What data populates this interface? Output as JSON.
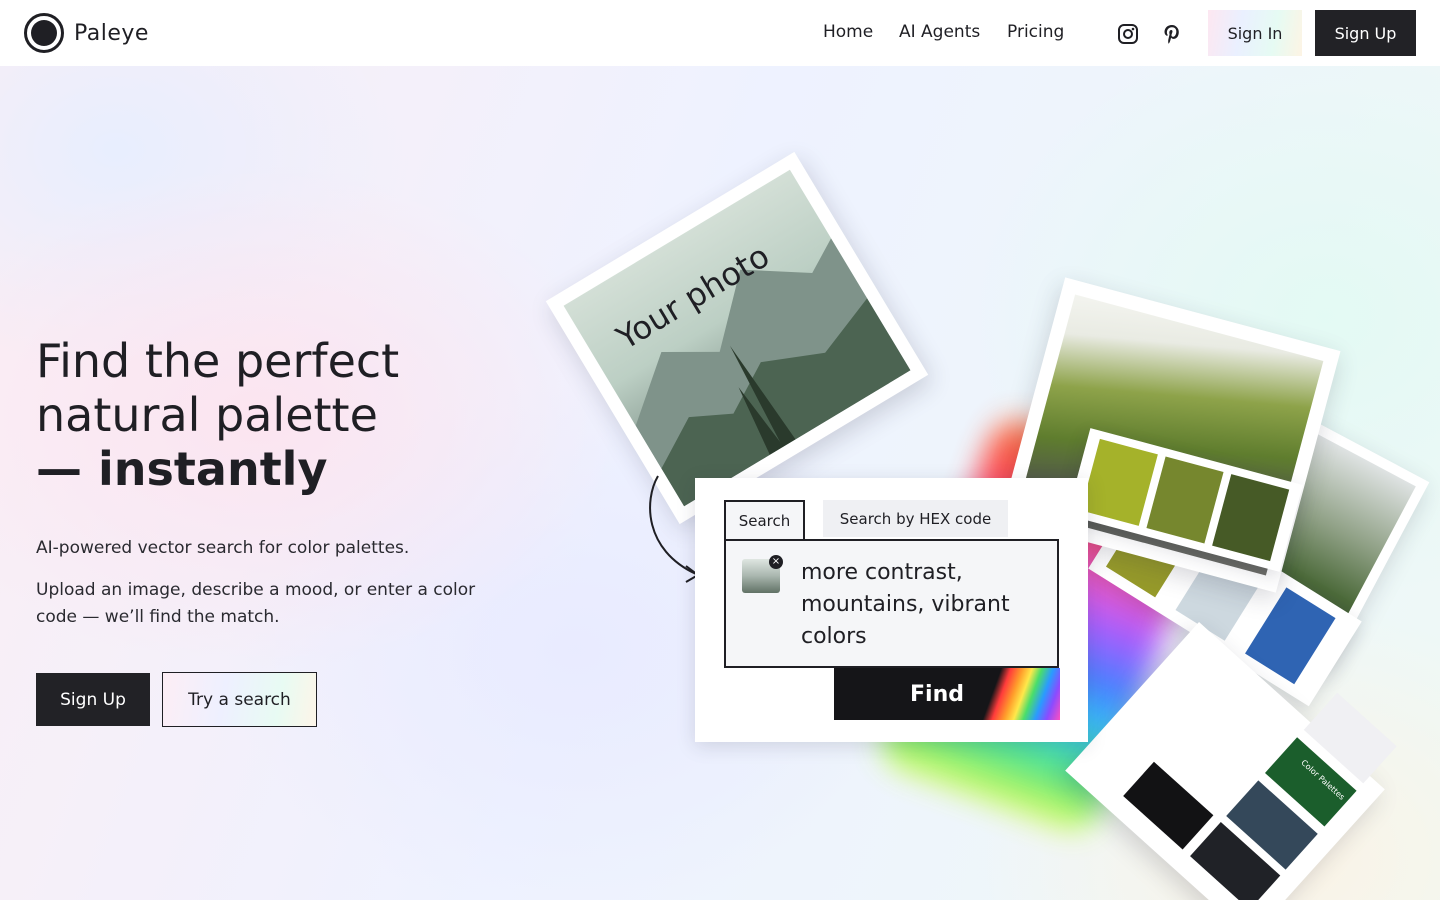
{
  "header": {
    "brand": "Paleye",
    "nav": [
      {
        "label": "Home"
      },
      {
        "label": "AI Agents"
      },
      {
        "label": "Pricing"
      }
    ],
    "social": [
      {
        "icon": "instagram-icon"
      },
      {
        "icon": "pinterest-icon"
      }
    ],
    "sign_in": "Sign In",
    "sign_up": "Sign Up"
  },
  "hero": {
    "title_line1": "Find the perfect",
    "title_line2": "natural palette",
    "title_line3": "— instantly",
    "subtitle": "AI-powered vector search for color palettes.",
    "description": "Upload an image, describe a mood, or enter a color code — we’ll find the match.",
    "primary_cta": "Sign Up",
    "secondary_cta": "Try a search"
  },
  "illustration": {
    "photo_label": "Your photo",
    "search_tab": "Search",
    "hex_tab": "Search by HEX code",
    "query": "more contrast, mountains, vibrant colors",
    "find_button": "Find",
    "palette_label": "Color Palettes",
    "swatches_1": [
      "#a5b22a",
      "#76872e",
      "#465a26"
    ],
    "swatches_2": [
      "#969a2a",
      "#cdd8df",
      "#2f64b3"
    ],
    "swatches_3": [
      "#1b5e2c",
      "#f0f0f3",
      "#34485a",
      "#202227",
      "#121214"
    ]
  },
  "colors": {
    "primary": "#222226",
    "text": "#1f1f24"
  }
}
